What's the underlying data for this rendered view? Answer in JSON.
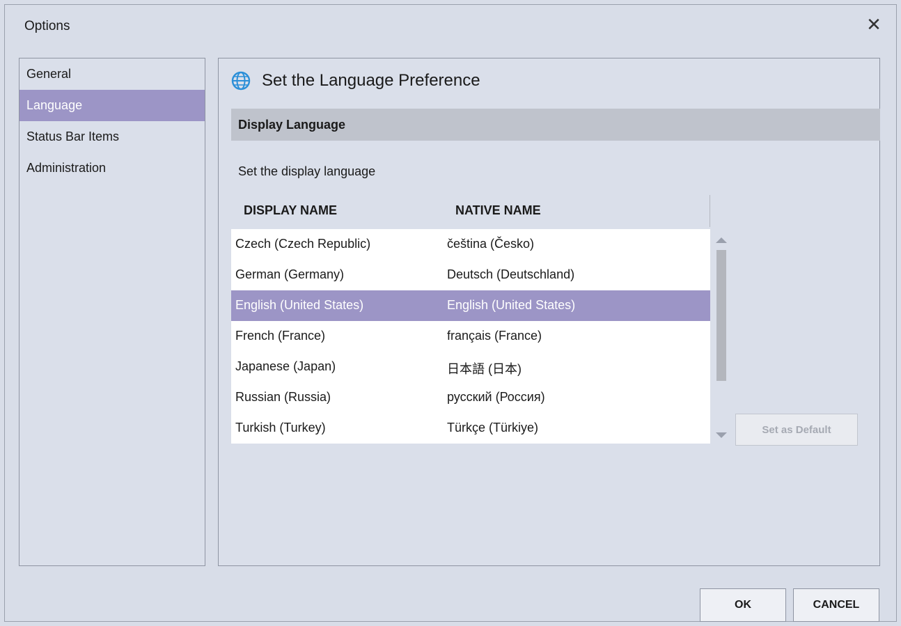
{
  "window": {
    "title": "Options",
    "close_glyph": "✕"
  },
  "sidebar": {
    "items": [
      {
        "label": "General"
      },
      {
        "label": "Language"
      },
      {
        "label": "Status Bar Items"
      },
      {
        "label": "Administration"
      }
    ],
    "active_index": 1
  },
  "main": {
    "heading": "Set the Language Preference",
    "heading_icon": "globe-icon",
    "section_title": "Display Language",
    "description": "Set the display language",
    "table": {
      "columns": [
        "DISPLAY NAME",
        "NATIVE NAME"
      ],
      "rows": [
        {
          "display": "Czech (Czech Republic)",
          "native": "čeština (Česko)"
        },
        {
          "display": "German (Germany)",
          "native": "Deutsch (Deutschland)"
        },
        {
          "display": "English (United States)",
          "native": "English (United States)"
        },
        {
          "display": "French (France)",
          "native": "français (France)"
        },
        {
          "display": "Japanese (Japan)",
          "native": "日本語 (日本)"
        },
        {
          "display": "Russian (Russia)",
          "native": "русский (Россия)"
        },
        {
          "display": "Turkish (Turkey)",
          "native": "Türkçe (Türkiye)"
        }
      ],
      "selected_index": 2
    },
    "set_default_label": "Set as Default"
  },
  "footer": {
    "ok_label": "OK",
    "cancel_label": "CANCEL"
  },
  "colors": {
    "selection": "#9c95c6",
    "background": "#d8dde8",
    "section_bar": "#bfc3cc",
    "globe": "#2b8fd8"
  }
}
